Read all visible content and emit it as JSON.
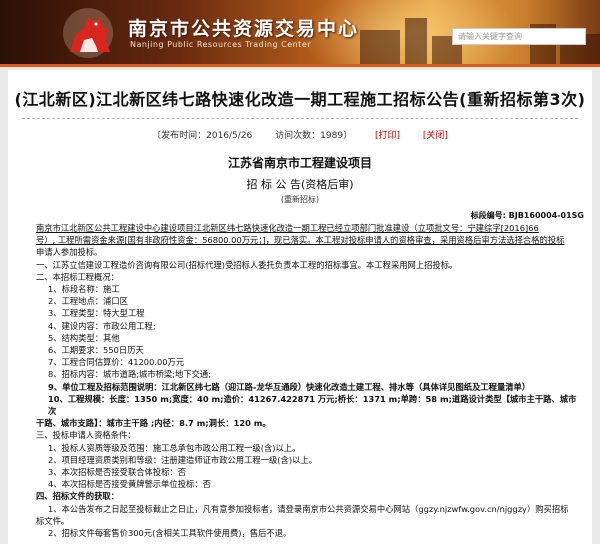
{
  "header": {
    "title": "南京市公共资源交易中心",
    "subtitle": "Nanjing Public Resources Trading Center",
    "search_placeholder": "请输入关键字查询"
  },
  "article": {
    "title": "(江北新区)江北新区纬七路快速化改造一期工程施工招标公告(重新招标第3次)",
    "publish_time": "〔发布时间：2016/5/26",
    "visits": "访问次数：1989〕",
    "print": "[打印]",
    "close": "[关闭]",
    "project": "江苏省南京市工程建设项目",
    "notice": "招 标 公 告(资格后审)",
    "standard": "(重新招标)",
    "bid_no": "标段编号: BJB160004-01SG",
    "intro_1": "南京市江北新区公共工程建设中心建设项目江北新区纬七路快速化改造一期工程已经立项部门批准建设（立项批文号：宁建综字[2016]66",
    "intro_2": "号）, 工程所需资金来源[国有非政府性资金：56800.00万元；]，现已落实。本工程对投标申请人的资格审查，采用资格后审方法选择合格的投标",
    "intro_3": "申请人参加投标。",
    "s1": "一、江苏立信建设工程造价咨询有限公司(招标代理)受招标人委托负责本工程的招标事宜。本工程采用网上招投标。",
    "s2": "二、本招标工程概况：",
    "items": [
      "1、标段名称：施工",
      "2、工程地点：浦口区",
      "3、工程类型：特大型工程",
      "4、建设内容：市政公用工程;",
      "5、结构类型：其他",
      "6、工期要求：550日历天",
      "7、工程合同估算价：41200.00万元",
      "8、招标内容：城市道路;城市桥梁;地下交通;",
      "9、单位工程及招标范围说明：江北新区纬七路（迎江路-龙华互通段）快速化改造土建工程、排水等（具体详见图纸及工程量清单）",
      "10、工程规模：长度：1350 m;宽度：40 m;造价：41267.422871 万元;桥长：1371 m;单跨：58 m;道路设计类型【城市主干路、城市次",
      "干路、城市支路】：城市主干路 ;内径：8.7 m;洞长：120 m。"
    ],
    "s3": "三、投标申请人资格条件：",
    "quals": [
      "1、投标人资质等级及范围：施工总承包市政公用工程一级(含)以上。",
      "2、项目经理资质类别和等级：注册建造师证市政公用工程一级(含)以上。",
      "3、本次招标是否接受联合体投标：否",
      "4、本次招标是否接受黄牌警示单位投标：否"
    ],
    "s4": "四、招标文件的获取：",
    "get_1": "1、本公告发布之日起至投标截止之日止，凡有意参加投标者，请登录南京市公共资源交易中心网站（ggzy.njzwfw.gov.cn/njggzy）购买招标",
    "get_2": "标文件。",
    "get_3": "2、招标文件每套售价300元(含相关工具软件使用费)，售后不退。"
  }
}
